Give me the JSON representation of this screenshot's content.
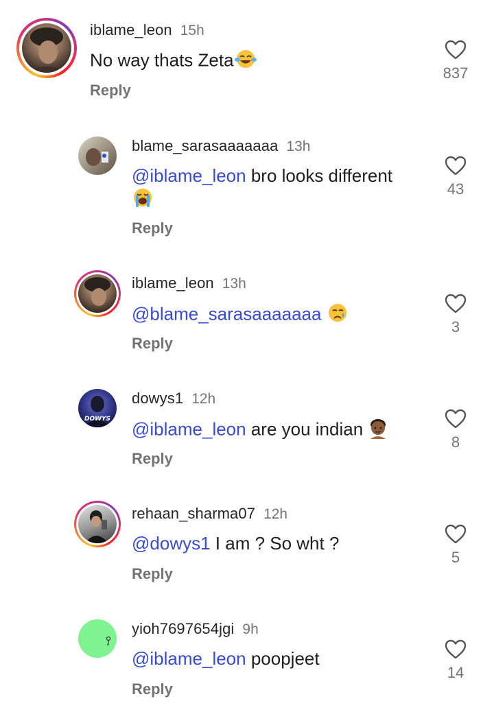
{
  "comments": [
    {
      "username": "iblame_leon",
      "time": "15h",
      "mention": "",
      "text": "No way thats Zeta",
      "emoji": "joy-emoji",
      "reply": "Reply",
      "likes": "837",
      "story_ring": true
    },
    {
      "username": "blame_sarasaaaaaaa",
      "time": "13h",
      "mention": "@iblame_leon",
      "text": " bro looks different",
      "emoji": "loudly-crying-emoji",
      "reply": "Reply",
      "likes": "43",
      "story_ring": false
    },
    {
      "username": "iblame_leon",
      "time": "13h",
      "mention": "@blame_sarasaaaaaaa",
      "text": " ",
      "emoji": "crying-emoji",
      "reply": "Reply",
      "likes": "3",
      "story_ring": true
    },
    {
      "username": "dowys1",
      "time": "12h",
      "mention": "@iblame_leon",
      "text": " are you indian ",
      "emoji": "man-dark-skin-emoji",
      "reply": "Reply",
      "likes": "8",
      "story_ring": false,
      "avatar_label": "DOWYS"
    },
    {
      "username": "rehaan_sharma07",
      "time": "12h",
      "mention": "@dowys1",
      "text": " I am ? So wht ?",
      "emoji": "",
      "reply": "Reply",
      "likes": "5",
      "story_ring": true
    },
    {
      "username": "yioh7697654jgi",
      "time": "9h",
      "mention": "@iblame_leon",
      "text": " poopjeet",
      "emoji": "",
      "reply": "Reply",
      "likes": "14",
      "story_ring": false
    }
  ],
  "colors": {
    "mention": "#3a4bd0",
    "secondary_text": "#737373",
    "green_avatar": "#7ef38f"
  }
}
